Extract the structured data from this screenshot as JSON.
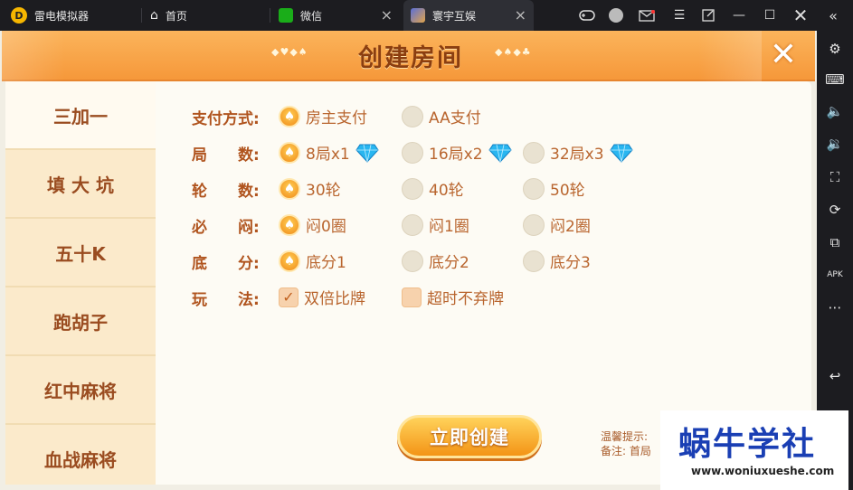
{
  "tabbar": {
    "app_name": "雷电模拟器",
    "tabs": [
      {
        "label": "首页"
      },
      {
        "label": "微信"
      },
      {
        "label": "寰宇互娱"
      }
    ],
    "close_glyph": "×"
  },
  "game": {
    "title": "创建房间",
    "left_deco": "◆♥◆♠",
    "right_deco": "◆♠◆♣",
    "side_menu": [
      "三加一",
      "填 大 坑",
      "五十K",
      "跑胡子",
      "红中麻将",
      "血战麻将"
    ],
    "selected_menu_index": 0,
    "rows": [
      {
        "label": "支付方式:",
        "options": [
          {
            "text": "房主支付",
            "selected": true
          },
          {
            "text": "AA支付",
            "selected": false
          }
        ]
      },
      {
        "label": "局　　数:",
        "options": [
          {
            "text": "8局x1",
            "selected": true,
            "diamond": true
          },
          {
            "text": "16局x2",
            "selected": false,
            "diamond": true
          },
          {
            "text": "32局x3",
            "selected": false,
            "diamond": true
          }
        ]
      },
      {
        "label": "轮　　数:",
        "options": [
          {
            "text": "30轮",
            "selected": true
          },
          {
            "text": "40轮",
            "selected": false
          },
          {
            "text": "50轮",
            "selected": false
          }
        ]
      },
      {
        "label": "必　　闷:",
        "options": [
          {
            "text": "闷0圈",
            "selected": true
          },
          {
            "text": "闷1圈",
            "selected": false
          },
          {
            "text": "闷2圈",
            "selected": false
          }
        ]
      },
      {
        "label": "底　　分:",
        "options": [
          {
            "text": "底分1",
            "selected": true
          },
          {
            "text": "底分2",
            "selected": false
          },
          {
            "text": "底分3",
            "selected": false
          }
        ]
      },
      {
        "label": "玩　　法:",
        "options": [
          {
            "text": "双倍比牌",
            "selected": true,
            "type": "checkbox"
          },
          {
            "text": "超时不弃牌",
            "selected": false,
            "type": "checkbox"
          }
        ]
      }
    ],
    "create_button": "立即创建",
    "tip_line1": "温馨提示:",
    "tip_line2": "备注: 首局"
  },
  "watermark": {
    "title": "蜗牛学社",
    "url": "www.woniuxueshe.com"
  },
  "colors": {
    "accent": "#f6983a",
    "label": "#b0541e",
    "diamond": "#29b6f0"
  }
}
